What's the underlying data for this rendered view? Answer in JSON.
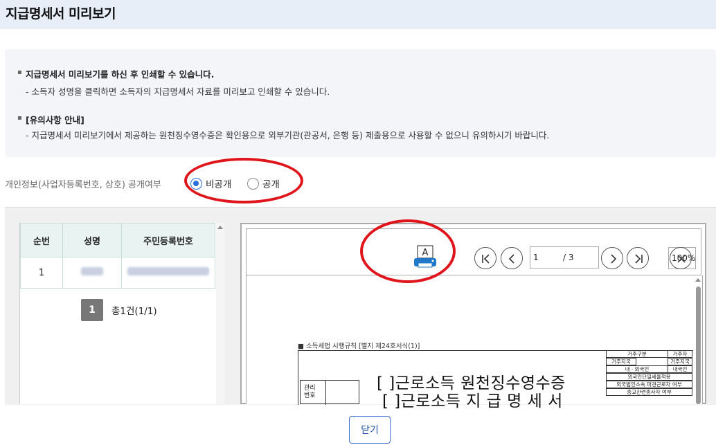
{
  "page_title": "지급명세서 미리보기",
  "notice": {
    "line1": "지급명세서 미리보기를 하신 후 인쇄할 수 있습니다.",
    "line2": "- 소득자 성명을 클릭하면 소득자의 지급명세서 자료를 미리보고 인쇄할 수 있습니다.",
    "line3": "[유의사항 안내]",
    "line4": "- 지급명세서 미리보기에서 제공하는 원천징수영수증은 확인용으로 외부기관(관공서, 은행 등) 제출용으로 사용할 수 없으니 유의하시기 바랍니다."
  },
  "privacy": {
    "label": "개인정보(사업자등록번호, 상호) 공개여부",
    "option_private": "비공개",
    "option_public": "공개",
    "selected": "비공개"
  },
  "list": {
    "headers": [
      "순번",
      "성명",
      "주민등록번호"
    ],
    "rows": [
      {
        "no": "1"
      }
    ],
    "page": "1",
    "total": "총1건(1/1)"
  },
  "viewer": {
    "current_page": "1",
    "total_pages": "/ 3",
    "zoom": "100%",
    "print_icon_letter": "A"
  },
  "document": {
    "caption": "■ 소득세법 시행규칙 [별지 제24호서식(1)]",
    "title1": "[  ]근로소득 원천징수영수증",
    "title2": "[  ]근로소득 지 급 명 세 서",
    "mgmt_label": "관리 번호",
    "right_table": [
      "거주구분",
      "거주자",
      "거주지국",
      "거주지국",
      "내ㆍ외국인",
      "내국인",
      "외국인단일세율적용",
      "외국법인소속 파견근로자 여부",
      "종교관련종사자 여부"
    ]
  },
  "buttons": {
    "close": "닫기"
  },
  "colors": {
    "header_bg": "#e8eef7",
    "accent": "#2a6ee0",
    "annotation_red": "#e0141b",
    "page_badge": "#777777"
  }
}
